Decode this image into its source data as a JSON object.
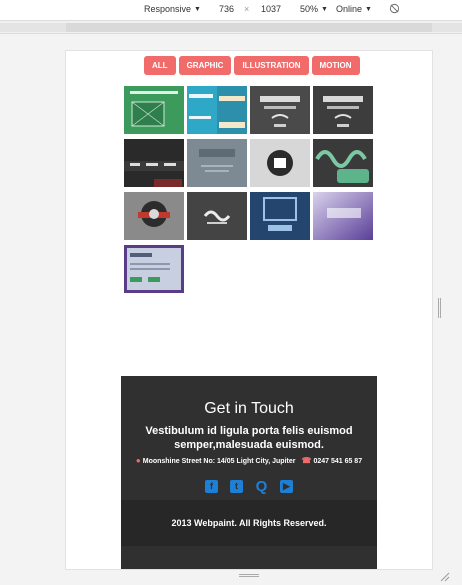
{
  "devtools": {
    "device": "Responsive",
    "width": "736",
    "times": "×",
    "height": "1037",
    "zoom": "50%",
    "network": "Online"
  },
  "filters": [
    "ALL",
    "GRAPHIC",
    "ILLUSTRATION",
    "MOTION"
  ],
  "portfolio": {
    "items": [
      {
        "name": "thumb-1",
        "bg": "#3c9a5d"
      },
      {
        "name": "thumb-2",
        "bg": "#2fa7c6"
      },
      {
        "name": "thumb-3",
        "bg": "#4a4a4a"
      },
      {
        "name": "thumb-4",
        "bg": "#3d3d3d"
      },
      {
        "name": "thumb-5",
        "bg": "#2a2a2a"
      },
      {
        "name": "thumb-6",
        "bg": "#7d8a93"
      },
      {
        "name": "thumb-7",
        "bg": "#d7d7d7"
      },
      {
        "name": "thumb-8",
        "bg": "#3a3a3a"
      },
      {
        "name": "thumb-9",
        "bg": "#8a8a8a"
      },
      {
        "name": "thumb-10",
        "bg": "#444444"
      },
      {
        "name": "thumb-11",
        "bg": "#23456e"
      },
      {
        "name": "thumb-12",
        "bg": "#6f5aa8"
      },
      {
        "name": "thumb-13",
        "bg": "#c7cfe0"
      }
    ]
  },
  "footer": {
    "title": "Get in Touch",
    "text": "Vestibulum id ligula porta felis euismod semper,malesuada euismod.",
    "address": "Moonshine Street No: 14/05 Light City, Jupiter",
    "phone": "0247 541 65 87",
    "social": [
      "facebook-icon",
      "twitter-icon",
      "q-icon",
      "youtube-icon"
    ],
    "copyright": "2013 Webpaint. All Rights Reserved."
  }
}
